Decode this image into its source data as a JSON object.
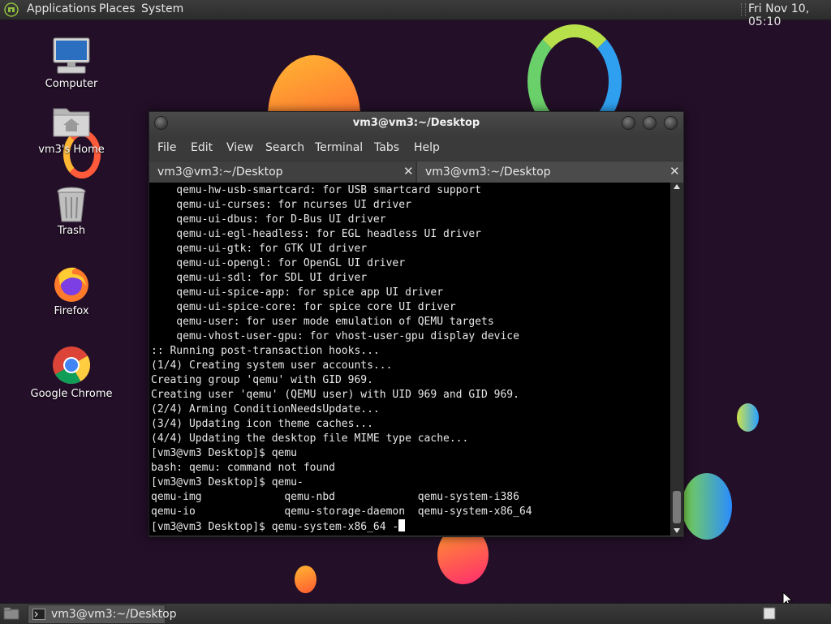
{
  "top_panel": {
    "menus": [
      "Applications",
      "Places",
      "System"
    ],
    "clock": "Fri Nov 10, 05:10"
  },
  "desktop_icons": [
    {
      "label": "Computer",
      "icon": "computer-icon"
    },
    {
      "label": "vm3's Home",
      "icon": "home-folder-icon"
    },
    {
      "label": "Trash",
      "icon": "trash-icon"
    },
    {
      "label": "Firefox",
      "icon": "firefox-icon"
    },
    {
      "label": "Google Chrome",
      "icon": "chrome-icon"
    }
  ],
  "terminal": {
    "title": "vm3@vm3:~/Desktop",
    "menu": [
      "File",
      "Edit",
      "View",
      "Search",
      "Terminal",
      "Tabs",
      "Help"
    ],
    "tabs": [
      {
        "label": "vm3@vm3:~/Desktop",
        "active": true
      },
      {
        "label": "vm3@vm3:~/Desktop",
        "active": false
      }
    ],
    "lines": [
      "    qemu-hw-usb-smartcard: for USB smartcard support",
      "    qemu-ui-curses: for ncurses UI driver",
      "    qemu-ui-dbus: for D-Bus UI driver",
      "    qemu-ui-egl-headless: for EGL headless UI driver",
      "    qemu-ui-gtk: for GTK UI driver",
      "    qemu-ui-opengl: for OpenGL UI driver",
      "    qemu-ui-sdl: for SDL UI driver",
      "    qemu-ui-spice-app: for spice app UI driver",
      "    qemu-ui-spice-core: for spice core UI driver",
      "    qemu-user: for user mode emulation of QEMU targets",
      "    qemu-vhost-user-gpu: for vhost-user-gpu display device",
      ":: Running post-transaction hooks...",
      "(1/4) Creating system user accounts...",
      "Creating group 'qemu' with GID 969.",
      "Creating user 'qemu' (QEMU user) with UID 969 and GID 969.",
      "(2/4) Arming ConditionNeedsUpdate...",
      "(3/4) Updating icon theme caches...",
      "(4/4) Updating the desktop file MIME type cache...",
      "[vm3@vm3 Desktop]$ qemu",
      "bash: qemu: command not found",
      "[vm3@vm3 Desktop]$ qemu-",
      "qemu-img             qemu-nbd             qemu-system-i386",
      "qemu-io              qemu-storage-daemon  qemu-system-x86_64"
    ],
    "prompt_line": "[vm3@vm3 Desktop]$ qemu-system-x86_64 -"
  },
  "taskbar": {
    "window_label": "vm3@vm3:~/Desktop"
  },
  "colors": {
    "desktop_bg": "#230f28",
    "panel_bg": "#333333",
    "terminal_bg": "#000000",
    "terminal_fg": "#e8e8e8"
  }
}
